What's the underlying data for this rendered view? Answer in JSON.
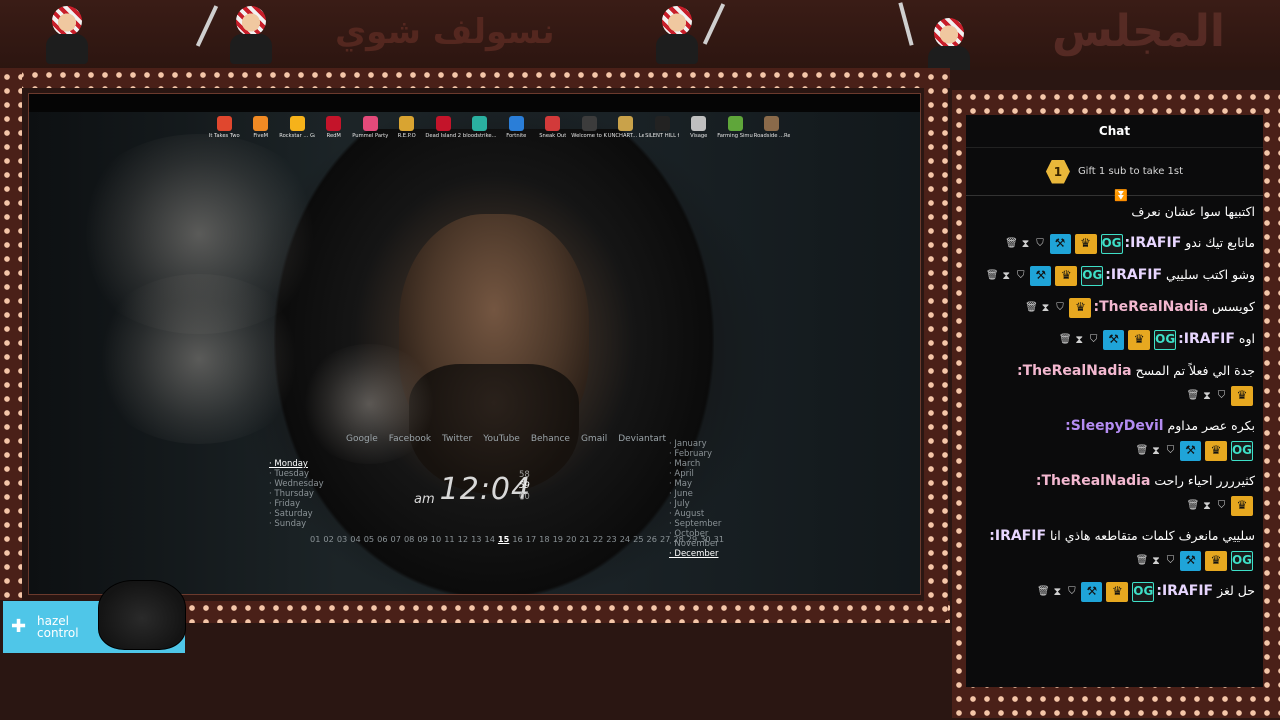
{
  "banner": {
    "title_ar": "المجلس",
    "subtitle_ar": "نسولف شوي"
  },
  "desktop": {
    "icons": [
      {
        "label": "It Takes Two",
        "color": "#e0472e"
      },
      {
        "label": "FiveM",
        "color": "#f08a24"
      },
      {
        "label": "Rockstar ... Games",
        "color": "#f6b21a"
      },
      {
        "label": "RedM",
        "color": "#c4142a"
      },
      {
        "label": "Pummel Party",
        "color": "#e34a7a"
      },
      {
        "label": "R.E.P.O",
        "color": "#d9a431"
      },
      {
        "label": "Dead Island 2",
        "color": "#c4142a"
      },
      {
        "label": "bloodstrike...",
        "color": "#2ab0a0"
      },
      {
        "label": "Fortnite",
        "color": "#2a7ed8"
      },
      {
        "label": "Sneak Out",
        "color": "#d23a3a"
      },
      {
        "label": "Welcome to Kowloon",
        "color": "#3c3c3c"
      },
      {
        "label": "UNCHART... Legacy of",
        "color": "#c9a24a"
      },
      {
        "label": "SILENT HILL f",
        "color": "#222222"
      },
      {
        "label": "Visage",
        "color": "#bfbfbf"
      },
      {
        "label": "Farming Simulator 25",
        "color": "#5fa63a"
      },
      {
        "label": "Roadside ...Researc",
        "color": "#8a6a4a"
      }
    ],
    "links": [
      "Google",
      "Facebook",
      "Twitter",
      "YouTube",
      "Behance",
      "Gmail",
      "Deviantart"
    ],
    "days": [
      "Monday",
      "Tuesday",
      "Wednesday",
      "Thursday",
      "Friday",
      "Saturday",
      "Sunday"
    ],
    "active_day": "Monday",
    "clock": {
      "ampm": "am",
      "time": "12:04"
    },
    "seconds": [
      "58",
      "59",
      "00"
    ],
    "dates": [
      "01",
      "02",
      "03",
      "04",
      "05",
      "06",
      "07",
      "08",
      "09",
      "10",
      "11",
      "12",
      "13",
      "14",
      "15",
      "16",
      "17",
      "18",
      "19",
      "20",
      "21",
      "22",
      "23",
      "24",
      "25",
      "26",
      "27",
      "28",
      "29",
      "30",
      "31"
    ],
    "active_date": "15",
    "months": [
      "January",
      "February",
      "March",
      "April",
      "May",
      "June",
      "July",
      "August",
      "September",
      "October",
      "November",
      "December"
    ],
    "active_month": "December"
  },
  "hazel": {
    "line1": "hazel",
    "line2": "control"
  },
  "chat": {
    "title": "Chat",
    "gift_rank": "1",
    "gift_text": "Gift 1 sub to take 1st",
    "messages": [
      {
        "user": "",
        "text": "اكتبيها سوا عشان نعرف",
        "color": "#ffffff",
        "badges": []
      },
      {
        "user": "IRAFIF:",
        "text": "ماتابع تيك ندو",
        "color": "#e8d6ff",
        "badges": [
          "bin",
          "hour",
          "shield",
          "hammer",
          "crown",
          "og"
        ]
      },
      {
        "user": "IRAFIF:",
        "text": "وشو اكتب سلييي",
        "color": "#e8d6ff",
        "badges": [
          "bin",
          "hour",
          "shield",
          "hammer",
          "crown",
          "og"
        ]
      },
      {
        "user": "TheRealNadia:",
        "text": "كويسس",
        "color": "#f3b8d0",
        "badges": [
          "bin",
          "hour",
          "shield",
          "crown"
        ]
      },
      {
        "user": "IRAFIF:",
        "text": "اوه",
        "color": "#e8d6ff",
        "badges": [
          "bin",
          "hour",
          "shield",
          "hammer",
          "crown",
          "og"
        ]
      },
      {
        "user": "TheRealNadia:",
        "text": "جدة الي فعلاً تم المسح",
        "color": "#f3b8d0",
        "badges": [
          "bin",
          "hour",
          "shield",
          "crown"
        ]
      },
      {
        "user": "SleepyDevil:",
        "text": "بكره عصر مداوم",
        "color": "#b48cf2",
        "badges": [
          "bin",
          "hour",
          "shield",
          "hammer",
          "crown",
          "og"
        ]
      },
      {
        "user": "TheRealNadia:",
        "text": "كثيرررر احياء راحت",
        "color": "#f3b8d0",
        "badges": [
          "bin",
          "hour",
          "shield",
          "crown"
        ]
      },
      {
        "user": "IRAFIF:",
        "text": "سلييي مانعرف كلمات متقاطعه هاذي انا",
        "color": "#e8d6ff",
        "badges": [
          "bin",
          "hour",
          "shield",
          "hammer",
          "crown",
          "og"
        ]
      },
      {
        "user": "IRAFIF:",
        "text": "حل لغز",
        "color": "#e8d6ff",
        "badges": [
          "bin",
          "hour",
          "shield",
          "hammer",
          "crown",
          "og"
        ]
      }
    ]
  }
}
